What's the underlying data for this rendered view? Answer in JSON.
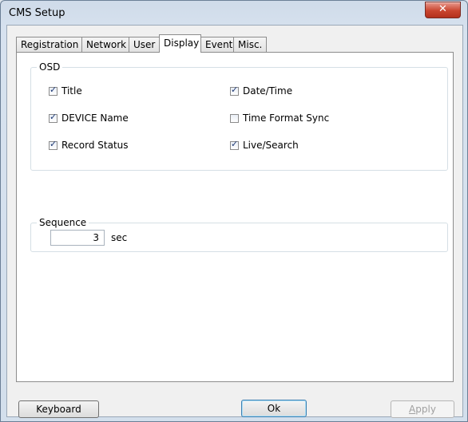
{
  "window": {
    "title": "CMS Setup",
    "close_glyph": "✕"
  },
  "tabs": [
    {
      "label": "Registration"
    },
    {
      "label": "Network"
    },
    {
      "label": "User"
    },
    {
      "label": "Display",
      "active": true
    },
    {
      "label": "Event"
    },
    {
      "label": "Misc."
    }
  ],
  "osd": {
    "label": "OSD",
    "items": [
      {
        "label": "Title",
        "checked": true
      },
      {
        "label": "Date/Time",
        "checked": true
      },
      {
        "label": "DEVICE Name",
        "checked": true
      },
      {
        "label": "Time Format Sync",
        "checked": false
      },
      {
        "label": "Record Status",
        "checked": true
      },
      {
        "label": "Live/Search",
        "checked": true
      }
    ]
  },
  "sequence": {
    "label": "Sequence",
    "value": "3",
    "unit": "sec"
  },
  "buttons": {
    "keyboard": "Keyboard",
    "ok": "Ok",
    "apply_first": "A",
    "apply_rest": "pply"
  },
  "colors": {
    "check": "#1f3a75",
    "close": "#c9452f"
  }
}
